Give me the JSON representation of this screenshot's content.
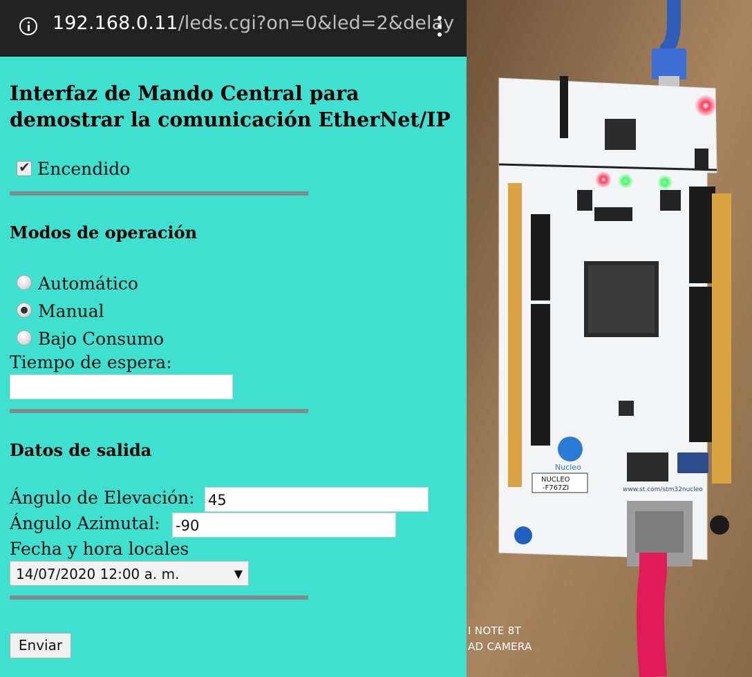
{
  "browser": {
    "url_host": "192.168.0.11",
    "url_path": "/leds.cgi?on=0&led=2&delay"
  },
  "page": {
    "title": "Interfaz de Mando Central para demostrar la comunicación EtherNet/IP",
    "power_checkbox": {
      "label": "Encendido",
      "checked": true
    },
    "modes": {
      "heading": "Modos de operación",
      "options": [
        {
          "label": "Automático",
          "selected": false
        },
        {
          "label": "Manual",
          "selected": true
        },
        {
          "label": "Bajo Consumo",
          "selected": false
        }
      ],
      "wait_time_label": "Tiempo de espera:",
      "wait_time_value": ""
    },
    "output": {
      "heading": "Datos de salida",
      "elevation_label": "Ángulo de Elevación:",
      "elevation_value": "45",
      "azimuth_label": "Ángulo Azimutal:",
      "azimuth_value": "-90",
      "datetime_label": "Fecha y hora locales",
      "datetime_value": "14/07/2020 12:00 a. m."
    },
    "submit_label": "Enviar"
  },
  "photo": {
    "watermark_line1": "I NOTE 8T",
    "watermark_line2": "AD CAMERA",
    "board_labels": {
      "brand": "Nucleo",
      "model_line1": "NUCLEO",
      "model_line2": "-F767ZI",
      "url": "www.st.com/stm32nucleo"
    }
  }
}
